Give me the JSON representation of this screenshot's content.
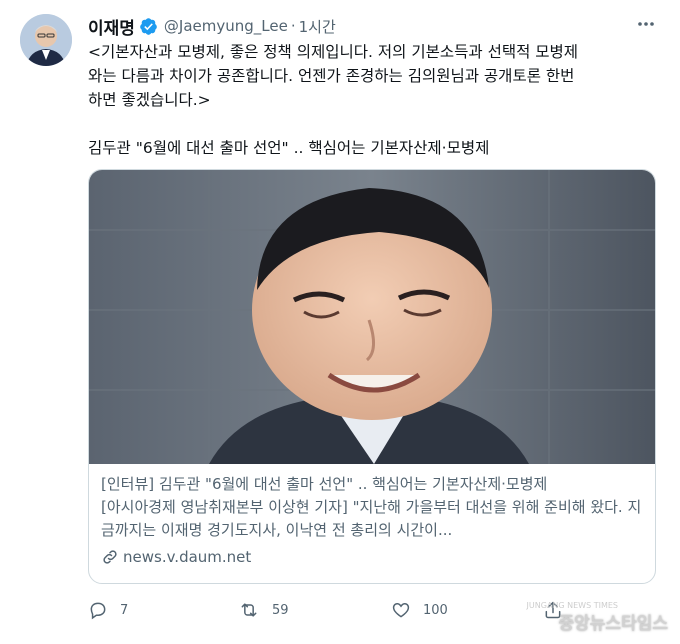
{
  "tweet": {
    "author_name": "이재명",
    "handle": "@Jaemyung_Lee",
    "separator": "·",
    "time": "1시간",
    "text": "<기본자산과 모병제, 좋은 정책 의제입니다. 저의 기본소득과 선택적 모병제\n와는 다름과 차이가 공존합니다. 언젠가 존경하는 김의원님과 공개토론 한번\n하면 좋겠습니다.>\n\n김두관 \"6월에 대선 출마 선언\" .. 핵심어는 기본자산제·모병제"
  },
  "card": {
    "title": "[인터뷰] 김두관 \"6월에 대선 출마 선언\" .. 핵심어는 기본자산제·모병제",
    "description": "[아시아경제 영남취재본부 이상현 기자] \"지난해 가을부터 대선을 위해 준비해 왔다. 지금까지는 이재명 경기도지사, 이낙연 전 총리의 시간이...",
    "domain": "news.v.daum.net"
  },
  "actions": {
    "reply_count": "7",
    "retweet_count": "59",
    "like_count": "100"
  },
  "watermark": {
    "main": "중앙뉴스타임스",
    "small": "JUNGANG NEWS TIMES"
  },
  "icons": [
    "verified-badge-icon",
    "more-icon",
    "link-icon",
    "reply-icon",
    "retweet-icon",
    "like-icon",
    "share-icon"
  ],
  "colors": {
    "verified": "#1d9bf0",
    "secondary_text": "#536471",
    "border": "#cfd9de"
  }
}
